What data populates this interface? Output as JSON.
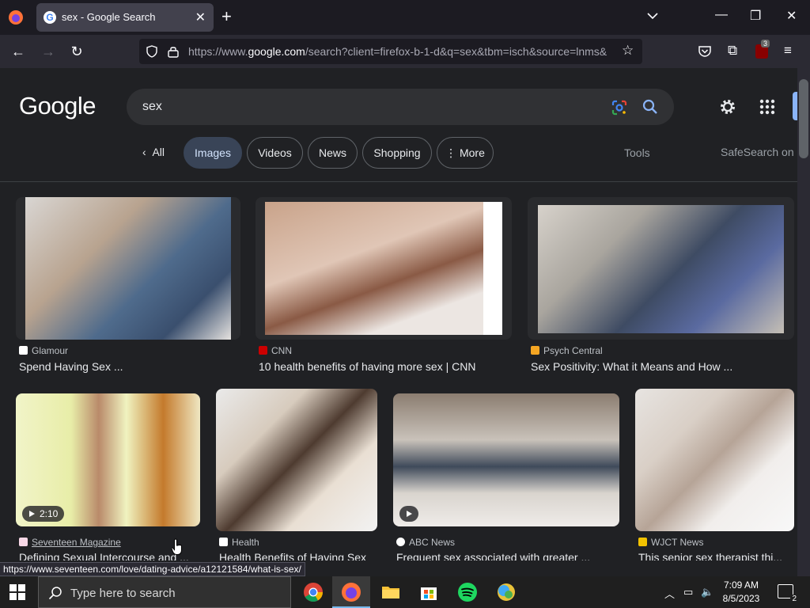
{
  "browser": {
    "tab_title": "sex - Google Search",
    "tab_favicon_letter": "G",
    "url_prefix": "https://www.",
    "url_domain": "google.com",
    "url_rest": "/search?client=firefox-b-1-d&q=sex&tbm=isch&source=lnms&",
    "extension_badge": "3"
  },
  "google": {
    "logo": "Google",
    "query": "sex",
    "chips": [
      {
        "label": "All"
      },
      {
        "label": "Images"
      },
      {
        "label": "Videos"
      },
      {
        "label": "News"
      },
      {
        "label": "Shopping"
      },
      {
        "label": "More"
      }
    ],
    "tools_label": "Tools",
    "safesearch_label": "SafeSearch on"
  },
  "results": [
    {
      "source": "Glamour",
      "caption": "Spend Having Sex ...",
      "icon_color": "#ffffff"
    },
    {
      "source": "CNN",
      "caption": "10 health benefits of having more sex | CNN",
      "icon_color": "#cc0000"
    },
    {
      "source": "Psych Central",
      "caption": "Sex Positivity: What it Means and How ...",
      "icon_color": "#f5a623"
    },
    {
      "source": "Seventeen Magazine",
      "caption": "Defining Sexual Intercourse and ...",
      "icon_color": "#f7d7e6",
      "duration": "2:10"
    },
    {
      "source": "Health",
      "caption": "Health Benefits of Having Sex",
      "icon_color": "#ffffff"
    },
    {
      "source": "ABC News",
      "caption": "Frequent sex associated with greater ...",
      "icon_color": "#ffffff"
    },
    {
      "source": "WJCT News",
      "caption": "This senior sex therapist thi...",
      "icon_color": "#f2c200"
    }
  ],
  "status_url": "https://www.seventeen.com/love/dating-advice/a12121584/what-is-sex/",
  "taskbar": {
    "search_placeholder": "Type here to search",
    "time": "7:09 AM",
    "date": "8/5/2023",
    "notification_count": "2"
  }
}
